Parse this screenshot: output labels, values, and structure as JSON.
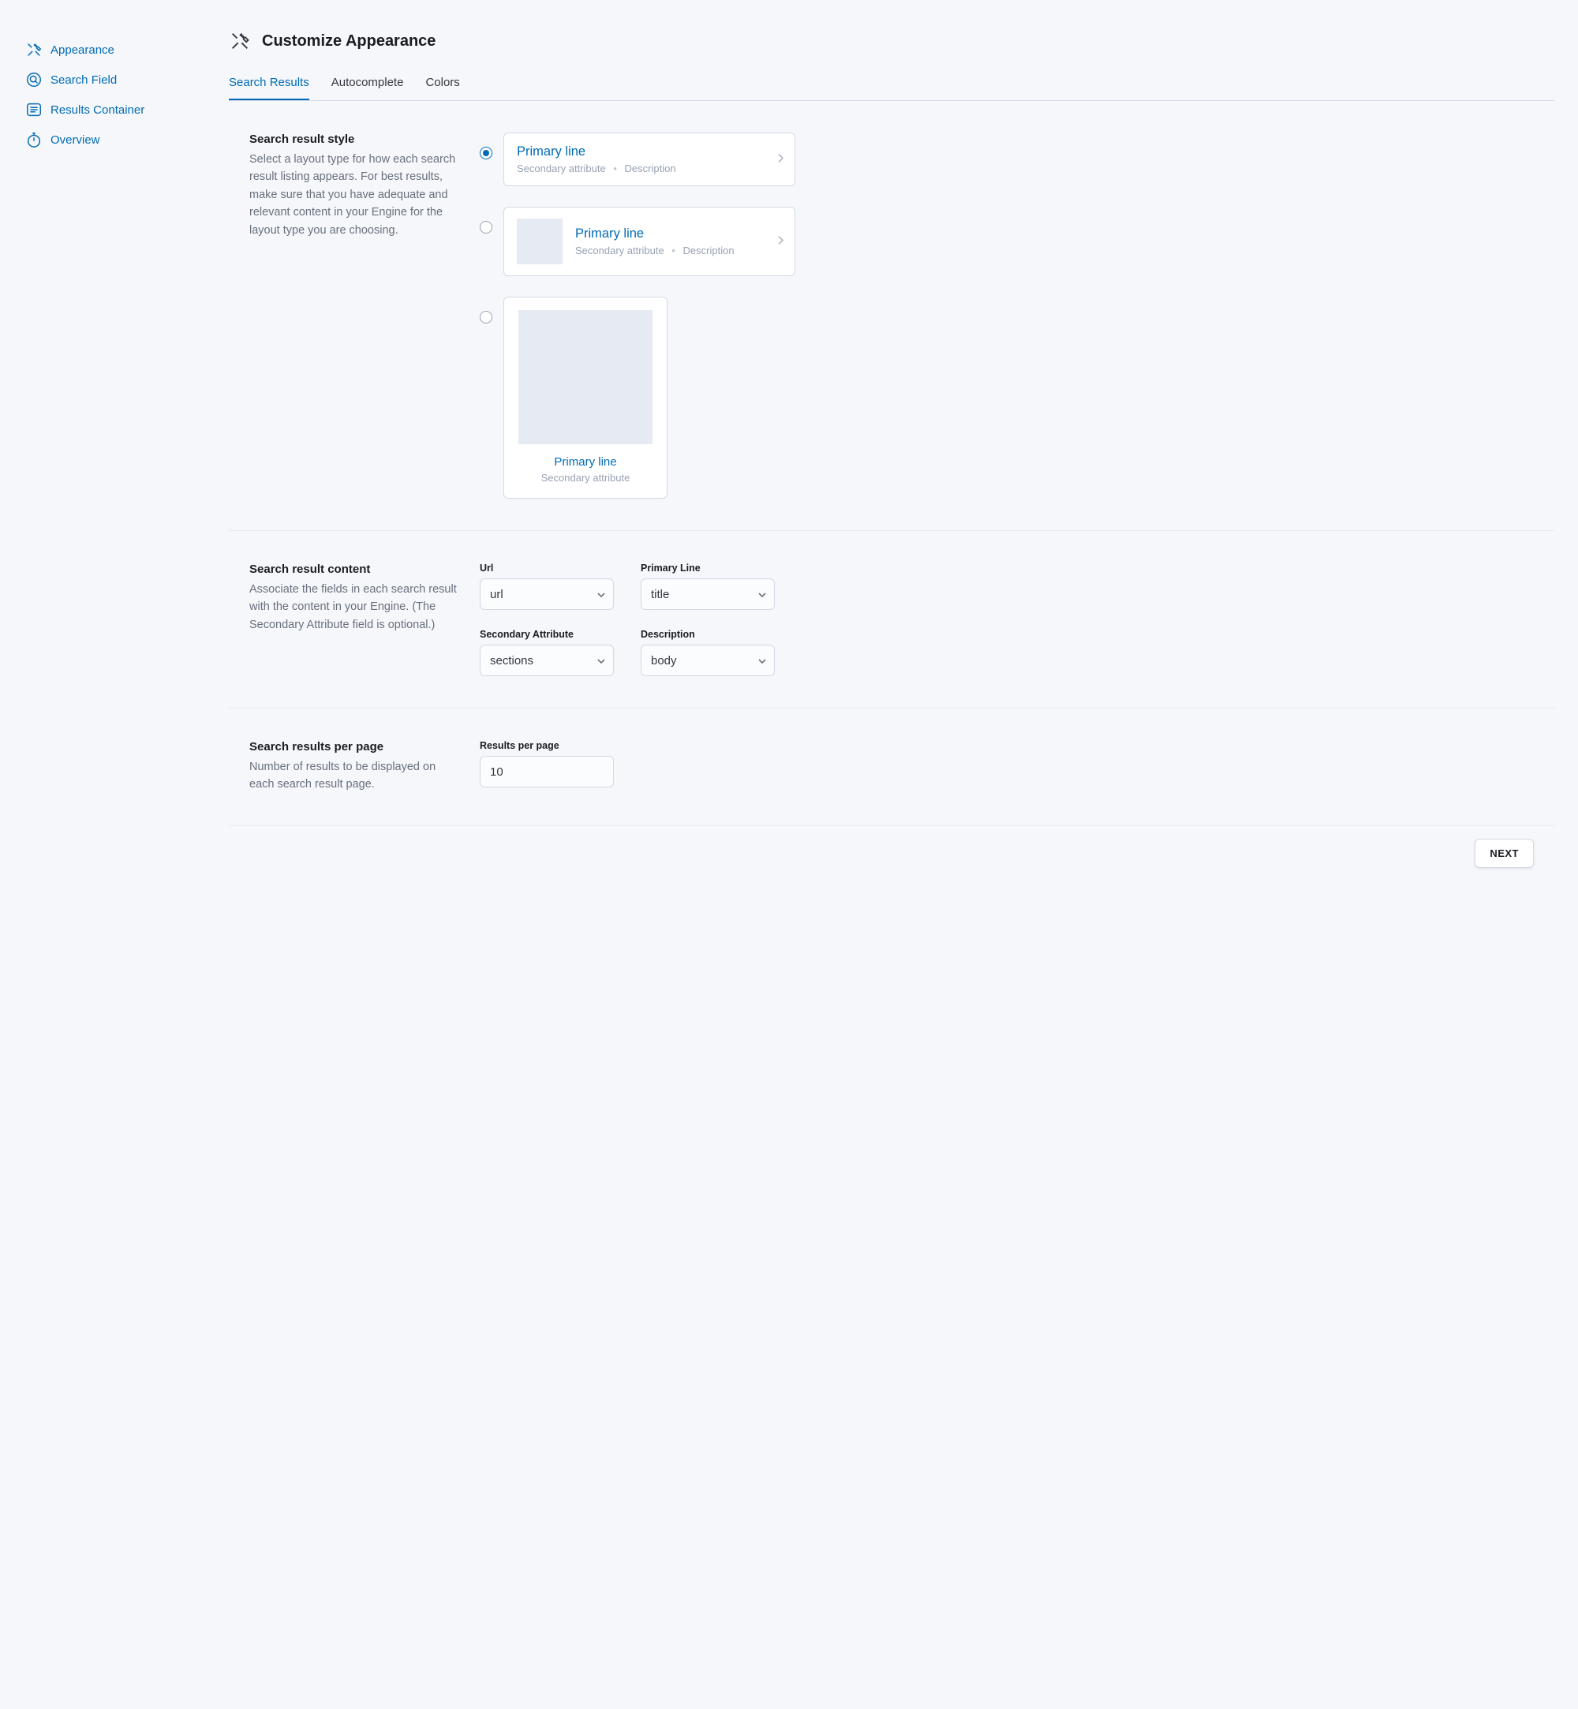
{
  "sidebar": {
    "items": [
      {
        "label": "Appearance"
      },
      {
        "label": "Search Field"
      },
      {
        "label": "Results Container"
      },
      {
        "label": "Overview"
      }
    ]
  },
  "header": {
    "title": "Customize Appearance"
  },
  "tabs": [
    {
      "label": "Search Results",
      "active": true
    },
    {
      "label": "Autocomplete",
      "active": false
    },
    {
      "label": "Colors",
      "active": false
    }
  ],
  "sections": {
    "style": {
      "title": "Search result style",
      "desc": "Select a layout type for how each search result listing appears. For best results, make sure that you have adequate and relevant content in your Engine for the layout type you are choosing.",
      "card_primary": "Primary line",
      "card_secondary": "Secondary attribute",
      "card_description": "Description"
    },
    "content": {
      "title": "Search result content",
      "desc": "Associate the fields in each search result with the content in your Engine. (The Secondary Attribute field is optional.)",
      "fields": {
        "url_label": "Url",
        "url_value": "url",
        "primary_label": "Primary Line",
        "primary_value": "title",
        "secondary_label": "Secondary Attribute",
        "secondary_value": "sections",
        "description_label": "Description",
        "description_value": "body"
      }
    },
    "perpage": {
      "title": "Search results per page",
      "desc": "Number of results to be displayed on each search result page.",
      "label": "Results per page",
      "value": "10"
    }
  },
  "footer": {
    "next": "Next"
  }
}
